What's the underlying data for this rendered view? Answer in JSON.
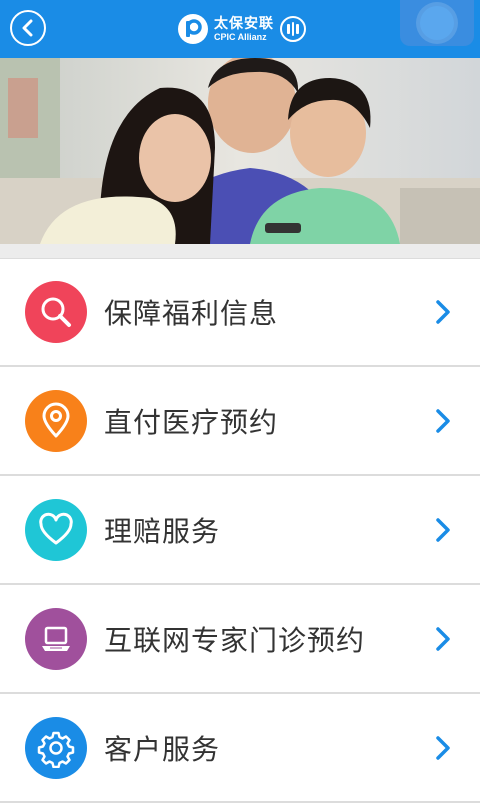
{
  "header": {
    "back_icon": "back-arrow-icon",
    "brand_cn": "太保安联",
    "brand_en": "CPIC Allianz",
    "color": "#1a8ce6"
  },
  "banner": {
    "description_icon": "family-photo"
  },
  "menu": [
    {
      "label": "保障福利信息",
      "icon": "search-icon",
      "color": "#f0445a"
    },
    {
      "label": "直付医疗预约",
      "icon": "location-pin-icon",
      "color": "#f8811a"
    },
    {
      "label": "理赔服务",
      "icon": "heart-icon",
      "color": "#1fc6d6"
    },
    {
      "label": "互联网专家门诊预约",
      "icon": "laptop-icon",
      "color": "#a0509c"
    },
    {
      "label": "客户服务",
      "icon": "gear-icon",
      "color": "#1a8ce6"
    }
  ],
  "colors": {
    "arrow": "#1a8ce6",
    "text": "#333333"
  }
}
